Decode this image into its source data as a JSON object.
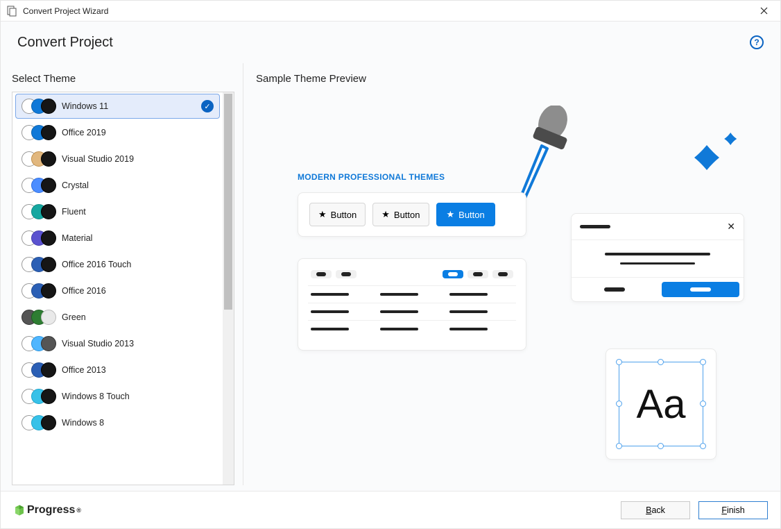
{
  "window": {
    "title": "Convert Project Wizard"
  },
  "header": {
    "title": "Convert Project"
  },
  "left": {
    "title": "Select Theme",
    "themes": [
      {
        "label": "Windows 11",
        "swatches": [
          "c-white",
          "c-blue",
          "c-black"
        ],
        "selected": true
      },
      {
        "label": "Office 2019",
        "swatches": [
          "c-white",
          "c-blue",
          "c-black"
        ]
      },
      {
        "label": "Visual Studio 2019",
        "swatches": [
          "c-white",
          "c-tan",
          "c-black"
        ]
      },
      {
        "label": "Crystal",
        "swatches": [
          "c-white",
          "c-lblue",
          "c-black"
        ]
      },
      {
        "label": "Fluent",
        "swatches": [
          "c-white",
          "c-teal",
          "c-black"
        ]
      },
      {
        "label": "Material",
        "swatches": [
          "c-white",
          "c-purple",
          "c-black"
        ]
      },
      {
        "label": "Office 2016 Touch",
        "swatches": [
          "c-white",
          "c-dblue",
          "c-black"
        ]
      },
      {
        "label": "Office 2016",
        "swatches": [
          "c-white",
          "c-dblue",
          "c-black"
        ]
      },
      {
        "label": "Green",
        "swatches": [
          "c-grey",
          "c-green",
          "c-lgrey"
        ]
      },
      {
        "label": "Visual Studio 2013",
        "swatches": [
          "c-white",
          "c-sky",
          "c-grey"
        ]
      },
      {
        "label": "Office 2013",
        "swatches": [
          "c-white",
          "c-dblue",
          "c-black"
        ]
      },
      {
        "label": "Windows 8 Touch",
        "swatches": [
          "c-white",
          "c-cyan",
          "c-black"
        ]
      },
      {
        "label": "Windows 8",
        "swatches": [
          "c-white",
          "c-cyan",
          "c-black"
        ]
      }
    ]
  },
  "right": {
    "title": "Sample Theme Preview",
    "tag": "MODERN PROFESSIONAL THEMES",
    "buttons": {
      "b1": "Button",
      "b2": "Button",
      "b3": "Button"
    },
    "aa": "Aa"
  },
  "footer": {
    "brand": "Progress",
    "back": "Back",
    "finish": "Finish"
  }
}
